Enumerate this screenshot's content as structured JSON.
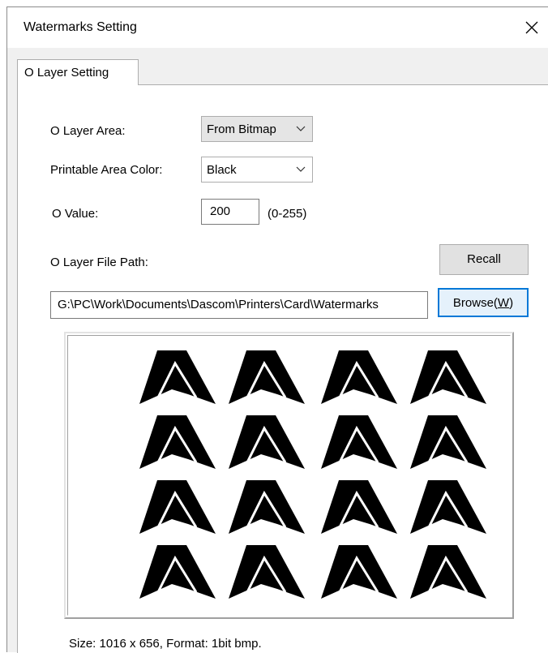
{
  "window": {
    "title": "Watermarks Setting",
    "close_icon": "close-icon"
  },
  "tabs": [
    {
      "label": "O Layer Setting",
      "selected": true
    }
  ],
  "form": {
    "o_layer_area": {
      "label": "O Layer Area:",
      "value": "From Bitmap"
    },
    "printable_area_color": {
      "label": "Printable Area Color:",
      "value": "Black"
    },
    "o_value": {
      "label": "O Value:",
      "value": "200",
      "range_hint": "(0-255)"
    },
    "o_layer_file_path": {
      "label": "O Layer File Path:",
      "value": "G:\\PC\\Work\\Documents\\Dascom\\Printers\\Card\\Watermarks"
    }
  },
  "buttons": {
    "recall": "Recall",
    "browse": "Browse(W)",
    "browse_prefix": "Browse(",
    "browse_mnemonic": "W",
    "browse_suffix": ")"
  },
  "preview": {
    "description_icon": "watermark-logo-pattern",
    "rows": 4,
    "cols": 4,
    "fill_color": "#000000"
  },
  "status": {
    "text": "Size: 1016 x 656, Format: 1bit bmp."
  },
  "colors": {
    "accent": "#0078d7",
    "dialog_bg": "#f0f0f0",
    "panel_bg": "#ffffff"
  }
}
